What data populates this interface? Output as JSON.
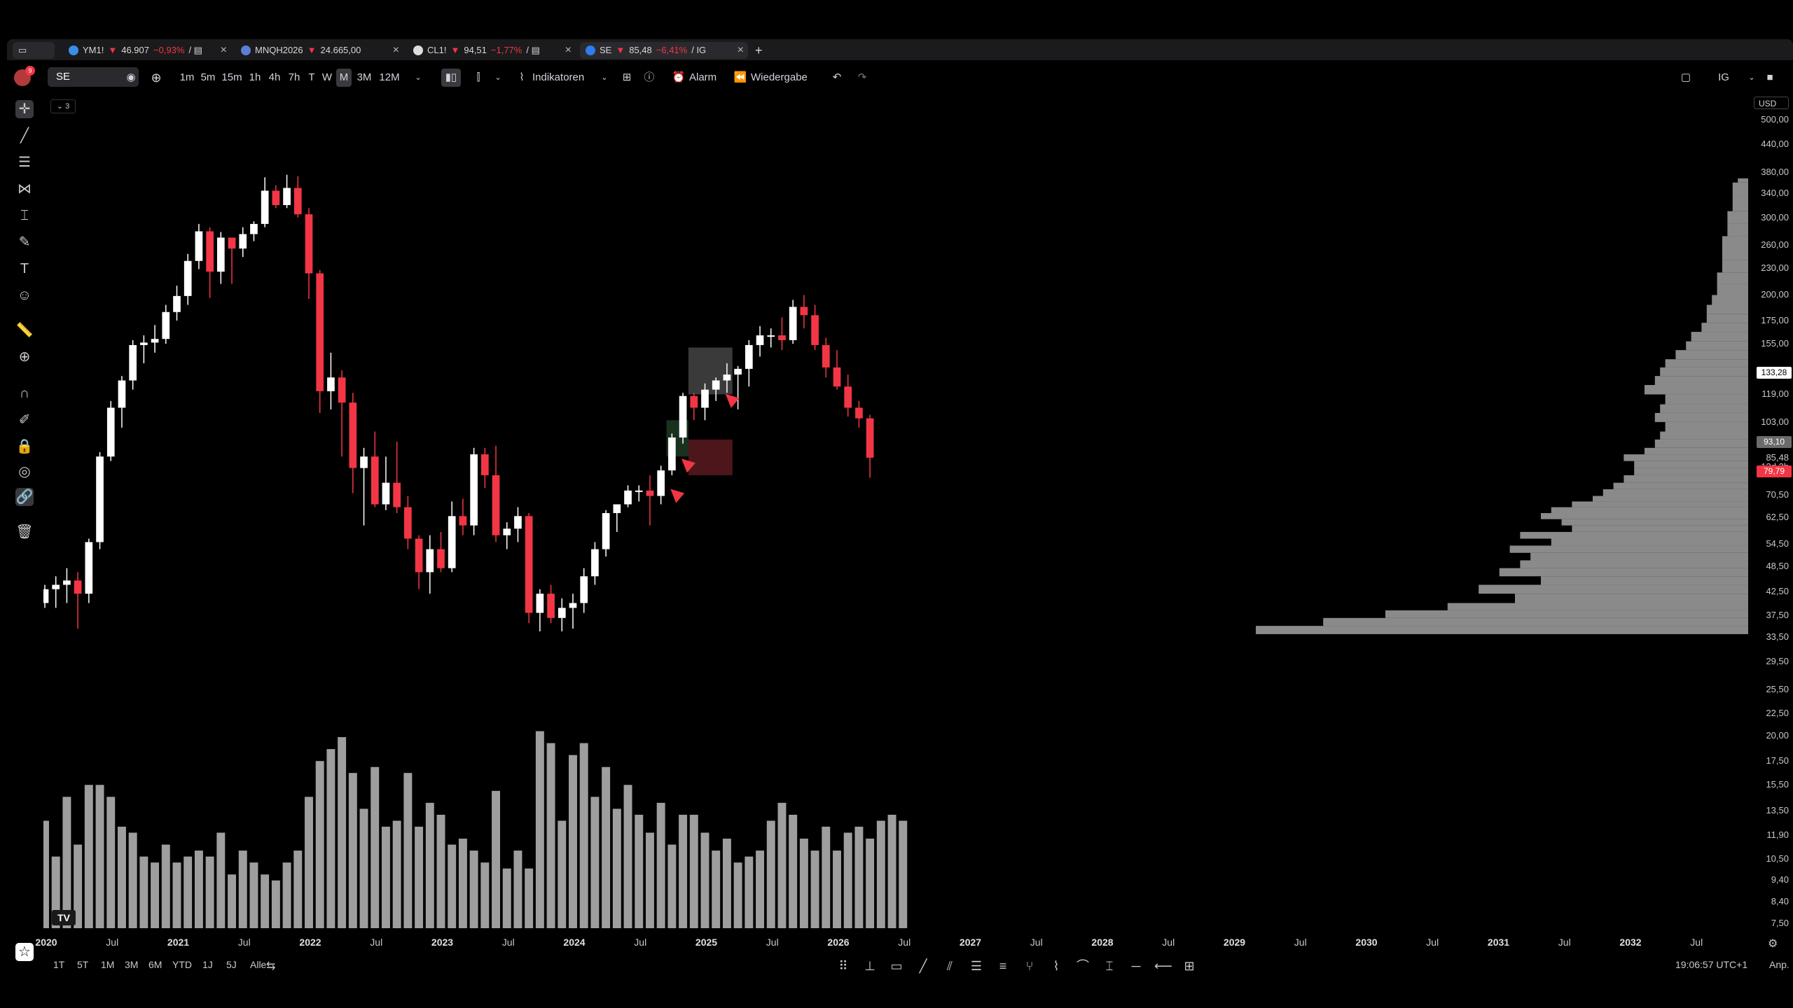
{
  "tabs": [
    {
      "symbol": "YM1!",
      "arrow": "▼",
      "price": "46.907",
      "change": "−0,93%",
      "suffix": "/ ▤",
      "dot": "#3b8ee8"
    },
    {
      "symbol": "MNQH2026",
      "arrow": "▼",
      "price": "24.665,00",
      "change": "",
      "suffix": "",
      "dot": "#5b7fd6"
    },
    {
      "symbol": "CL1!",
      "arrow": "▼",
      "price": "94,51",
      "change": "−1,77%",
      "suffix": "/ ▤",
      "dot": "#dddddd"
    },
    {
      "symbol": "SE",
      "arrow": "▼",
      "price": "85,48",
      "change": "−6,41%",
      "suffix": "/ IG",
      "dot": "#2f7bf0"
    }
  ],
  "new_tab_label": "+",
  "toolbar": {
    "symbol": "SE",
    "intervals": [
      "1m",
      "5m",
      "15m",
      "1h",
      "4h",
      "7h",
      "T",
      "W",
      "M",
      "3M",
      "12M"
    ],
    "selected_interval": "M",
    "indicators_label": "Indikatoren",
    "alert_label": "Alarm",
    "replay_label": "Wiedergabe",
    "right_label": "IG"
  },
  "notification_count": "9",
  "collapse_label": "3",
  "currency_label": "USD",
  "price_axis": [
    "500,00",
    "440,00",
    "380,00",
    "340,00",
    "300,00",
    "260,00",
    "230,00",
    "200,00",
    "175,00",
    "155,00",
    "133,28",
    "119,00",
    "103,00",
    "93,10",
    "85,48",
    "13d 2h",
    "79,79",
    "70,50",
    "62,50",
    "54,50",
    "48,50",
    "42,50",
    "37,50",
    "33,50",
    "29,50",
    "25,50",
    "22,50",
    "20,00",
    "17,50",
    "15,50",
    "13,50",
    "11,90",
    "10,50",
    "9,40",
    "8,40",
    "7,50"
  ],
  "price_tags": {
    "high_marker": "133,28",
    "last_label": "93,10",
    "current": "85,48",
    "countdown": "13d 2h",
    "low_marker": "79,79"
  },
  "colors": {
    "up": "#ffffff",
    "down": "#f23645",
    "volume": "#9e9e9e",
    "profile": "#8a8a8a",
    "tag_red": "#f23645",
    "tag_grey": "#6b6b6b",
    "zone_green": "#1e3a22",
    "zone_red": "#5a1a20",
    "zone_grey": "#444444"
  },
  "x_axis": [
    {
      "label": "2020",
      "year": true
    },
    {
      "label": "Jul",
      "year": false
    },
    {
      "label": "2021",
      "year": true
    },
    {
      "label": "Jul",
      "year": false
    },
    {
      "label": "2022",
      "year": true
    },
    {
      "label": "Jul",
      "year": false
    },
    {
      "label": "2023",
      "year": true
    },
    {
      "label": "Jul",
      "year": false
    },
    {
      "label": "2024",
      "year": true
    },
    {
      "label": "Jul",
      "year": false
    },
    {
      "label": "2025",
      "year": true
    },
    {
      "label": "Jul",
      "year": false
    },
    {
      "label": "2026",
      "year": true
    },
    {
      "label": "Jul",
      "year": false
    },
    {
      "label": "2027",
      "year": true
    },
    {
      "label": "Jul",
      "year": false
    },
    {
      "label": "2028",
      "year": true
    },
    {
      "label": "Jul",
      "year": false
    },
    {
      "label": "2029",
      "year": true
    },
    {
      "label": "Jul",
      "year": false
    },
    {
      "label": "2030",
      "year": true
    },
    {
      "label": "Jul",
      "year": false
    },
    {
      "label": "2031",
      "year": true
    },
    {
      "label": "Jul",
      "year": false
    },
    {
      "label": "2032",
      "year": true
    },
    {
      "label": "Jul",
      "year": false
    }
  ],
  "ranges": [
    "1T",
    "5T",
    "1M",
    "3M",
    "6M",
    "YTD",
    "1J",
    "5J",
    "Alle"
  ],
  "clock": "19:06:57 UTC+1",
  "adj_label": "Anp.",
  "logo_text": "TV",
  "chart_data": {
    "type": "candlestick",
    "symbol": "SE",
    "interval": "monthly",
    "y_scale": "log",
    "ylim": [
      7.0,
      560
    ],
    "candles": [
      {
        "d": "2019-12",
        "o": 40,
        "h": 44,
        "l": 39,
        "c": 43
      },
      {
        "d": "2020-01",
        "o": 43,
        "h": 46,
        "l": 39,
        "c": 44
      },
      {
        "d": "2020-02",
        "o": 44,
        "h": 48,
        "l": 40,
        "c": 45
      },
      {
        "d": "2020-03",
        "o": 45,
        "h": 47,
        "l": 35,
        "c": 42
      },
      {
        "d": "2020-04",
        "o": 42,
        "h": 56,
        "l": 40,
        "c": 55
      },
      {
        "d": "2020-05",
        "o": 55,
        "h": 88,
        "l": 53,
        "c": 86
      },
      {
        "d": "2020-06",
        "o": 86,
        "h": 115,
        "l": 84,
        "c": 111
      },
      {
        "d": "2020-07",
        "o": 111,
        "h": 131,
        "l": 100,
        "c": 128
      },
      {
        "d": "2020-08",
        "o": 128,
        "h": 158,
        "l": 122,
        "c": 154
      },
      {
        "d": "2020-09",
        "o": 154,
        "h": 162,
        "l": 140,
        "c": 156
      },
      {
        "d": "2020-10",
        "o": 156,
        "h": 171,
        "l": 148,
        "c": 159
      },
      {
        "d": "2020-11",
        "o": 159,
        "h": 190,
        "l": 155,
        "c": 183
      },
      {
        "d": "2020-12",
        "o": 183,
        "h": 210,
        "l": 175,
        "c": 199
      },
      {
        "d": "2021-01",
        "o": 199,
        "h": 248,
        "l": 190,
        "c": 239
      },
      {
        "d": "2021-02",
        "o": 239,
        "h": 290,
        "l": 229,
        "c": 279
      },
      {
        "d": "2021-03",
        "o": 279,
        "h": 285,
        "l": 197,
        "c": 226
      },
      {
        "d": "2021-04",
        "o": 226,
        "h": 278,
        "l": 212,
        "c": 270
      },
      {
        "d": "2021-05",
        "o": 270,
        "h": 270,
        "l": 212,
        "c": 255
      },
      {
        "d": "2021-06",
        "o": 255,
        "h": 285,
        "l": 244,
        "c": 275
      },
      {
        "d": "2021-07",
        "o": 275,
        "h": 294,
        "l": 265,
        "c": 290
      },
      {
        "d": "2021-08",
        "o": 290,
        "h": 370,
        "l": 285,
        "c": 345
      },
      {
        "d": "2021-09",
        "o": 345,
        "h": 355,
        "l": 315,
        "c": 320
      },
      {
        "d": "2021-10",
        "o": 320,
        "h": 375,
        "l": 315,
        "c": 350
      },
      {
        "d": "2021-11",
        "o": 350,
        "h": 372,
        "l": 300,
        "c": 305
      },
      {
        "d": "2021-12",
        "o": 305,
        "h": 315,
        "l": 196,
        "c": 224
      },
      {
        "d": "2022-01",
        "o": 224,
        "h": 228,
        "l": 108,
        "c": 121
      },
      {
        "d": "2022-02",
        "o": 121,
        "h": 148,
        "l": 110,
        "c": 130
      },
      {
        "d": "2022-03",
        "o": 130,
        "h": 135,
        "l": 86,
        "c": 114
      },
      {
        "d": "2022-04",
        "o": 114,
        "h": 120,
        "l": 71,
        "c": 81
      },
      {
        "d": "2022-05",
        "o": 81,
        "h": 90,
        "l": 60,
        "c": 86
      },
      {
        "d": "2022-06",
        "o": 86,
        "h": 98,
        "l": 66,
        "c": 67
      },
      {
        "d": "2022-07",
        "o": 67,
        "h": 86,
        "l": 65,
        "c": 75
      },
      {
        "d": "2022-08",
        "o": 75,
        "h": 93,
        "l": 64,
        "c": 66
      },
      {
        "d": "2022-09",
        "o": 66,
        "h": 70,
        "l": 53,
        "c": 56
      },
      {
        "d": "2022-10",
        "o": 56,
        "h": 57,
        "l": 43,
        "c": 47
      },
      {
        "d": "2022-11",
        "o": 47,
        "h": 57,
        "l": 42,
        "c": 53
      },
      {
        "d": "2022-12",
        "o": 53,
        "h": 58,
        "l": 47,
        "c": 48
      },
      {
        "d": "2023-01",
        "o": 48,
        "h": 68,
        "l": 47,
        "c": 63
      },
      {
        "d": "2023-02",
        "o": 63,
        "h": 69,
        "l": 57,
        "c": 60
      },
      {
        "d": "2023-03",
        "o": 60,
        "h": 90,
        "l": 57,
        "c": 87
      },
      {
        "d": "2023-04",
        "o": 87,
        "h": 90,
        "l": 73,
        "c": 78
      },
      {
        "d": "2023-05",
        "o": 78,
        "h": 91,
        "l": 55,
        "c": 57
      },
      {
        "d": "2023-06",
        "o": 57,
        "h": 61,
        "l": 53,
        "c": 59
      },
      {
        "d": "2023-07",
        "o": 59,
        "h": 66,
        "l": 55,
        "c": 63
      },
      {
        "d": "2023-08",
        "o": 63,
        "h": 64,
        "l": 36,
        "c": 38
      },
      {
        "d": "2023-09",
        "o": 38,
        "h": 43,
        "l": 34.5,
        "c": 42
      },
      {
        "d": "2023-10",
        "o": 42,
        "h": 44,
        "l": 36,
        "c": 37
      },
      {
        "d": "2023-11",
        "o": 37,
        "h": 41,
        "l": 34.5,
        "c": 39
      },
      {
        "d": "2023-12",
        "o": 39,
        "h": 42,
        "l": 35,
        "c": 40
      },
      {
        "d": "2024-01",
        "o": 40,
        "h": 48,
        "l": 38,
        "c": 46
      },
      {
        "d": "2024-02",
        "o": 46,
        "h": 55,
        "l": 44,
        "c": 53
      },
      {
        "d": "2024-03",
        "o": 53,
        "h": 65,
        "l": 51,
        "c": 64
      },
      {
        "d": "2024-04",
        "o": 64,
        "h": 67,
        "l": 58,
        "c": 67
      },
      {
        "d": "2024-05",
        "o": 67,
        "h": 74,
        "l": 66,
        "c": 72
      },
      {
        "d": "2024-06",
        "o": 72,
        "h": 74,
        "l": 68,
        "c": 72
      },
      {
        "d": "2024-07",
        "o": 72,
        "h": 78,
        "l": 60,
        "c": 70
      },
      {
        "d": "2024-08",
        "o": 70,
        "h": 82,
        "l": 67,
        "c": 80
      },
      {
        "d": "2024-09",
        "o": 80,
        "h": 97,
        "l": 78,
        "c": 95
      },
      {
        "d": "2024-10",
        "o": 95,
        "h": 120,
        "l": 92,
        "c": 118
      },
      {
        "d": "2024-11",
        "o": 118,
        "h": 120,
        "l": 104,
        "c": 111
      },
      {
        "d": "2024-12",
        "o": 111,
        "h": 126,
        "l": 104,
        "c": 122
      },
      {
        "d": "2025-01",
        "o": 122,
        "h": 130,
        "l": 115,
        "c": 128
      },
      {
        "d": "2025-02",
        "o": 128,
        "h": 140,
        "l": 120,
        "c": 132
      },
      {
        "d": "2025-03",
        "o": 132,
        "h": 138,
        "l": 110,
        "c": 136
      },
      {
        "d": "2025-04",
        "o": 136,
        "h": 158,
        "l": 124,
        "c": 154
      },
      {
        "d": "2025-05",
        "o": 154,
        "h": 170,
        "l": 145,
        "c": 162
      },
      {
        "d": "2025-06",
        "o": 162,
        "h": 168,
        "l": 152,
        "c": 162
      },
      {
        "d": "2025-07",
        "o": 162,
        "h": 178,
        "l": 150,
        "c": 158
      },
      {
        "d": "2025-08",
        "o": 158,
        "h": 195,
        "l": 155,
        "c": 188
      },
      {
        "d": "2025-09",
        "o": 188,
        "h": 200,
        "l": 168,
        "c": 180
      },
      {
        "d": "2025-10",
        "o": 180,
        "h": 190,
        "l": 150,
        "c": 154
      },
      {
        "d": "2025-11",
        "o": 154,
        "h": 160,
        "l": 130,
        "c": 137
      },
      {
        "d": "2025-12",
        "o": 137,
        "h": 150,
        "l": 122,
        "c": 124
      },
      {
        "d": "2026-01",
        "o": 124,
        "h": 132,
        "l": 106,
        "c": 111
      },
      {
        "d": "2026-02",
        "o": 111,
        "h": 115,
        "l": 100,
        "c": 105
      },
      {
        "d": "2026-03",
        "o": 105,
        "h": 107,
        "l": 77,
        "c": 85.48
      }
    ],
    "volume": [
      18,
      12,
      22,
      14,
      24,
      24,
      22,
      17,
      16,
      12,
      11,
      14,
      11,
      12,
      13,
      12,
      16,
      9,
      13,
      11,
      9,
      8,
      11,
      13,
      22,
      28,
      30,
      32,
      26,
      20,
      27,
      17,
      18,
      26,
      17,
      21,
      19,
      14,
      15,
      13,
      11,
      23,
      10,
      13,
      10,
      33,
      31,
      18,
      29,
      31,
      22,
      27,
      20,
      24,
      19,
      16,
      21,
      14,
      19,
      19,
      16,
      13,
      15,
      11,
      12,
      13,
      18,
      21,
      19,
      15,
      13,
      17,
      13,
      16,
      17,
      15,
      18,
      19,
      18
    ],
    "volume_profile": [
      {
        "price": 34.0,
        "w": 0.95
      },
      {
        "price": 35.5,
        "w": 0.82
      },
      {
        "price": 37.0,
        "w": 0.7
      },
      {
        "price": 38.5,
        "w": 0.58
      },
      {
        "price": 40.0,
        "w": 0.45
      },
      {
        "price": 42.0,
        "w": 0.52
      },
      {
        "price": 44.0,
        "w": 0.4
      },
      {
        "price": 46.0,
        "w": 0.48
      },
      {
        "price": 48.0,
        "w": 0.44
      },
      {
        "price": 50.0,
        "w": 0.42
      },
      {
        "price": 52.0,
        "w": 0.46
      },
      {
        "price": 54.0,
        "w": 0.38
      },
      {
        "price": 56.0,
        "w": 0.44
      },
      {
        "price": 58.0,
        "w": 0.34
      },
      {
        "price": 60.0,
        "w": 0.36
      },
      {
        "price": 62.0,
        "w": 0.4
      },
      {
        "price": 64.0,
        "w": 0.38
      },
      {
        "price": 66.0,
        "w": 0.34
      },
      {
        "price": 68.0,
        "w": 0.3
      },
      {
        "price": 70.0,
        "w": 0.28
      },
      {
        "price": 72.5,
        "w": 0.26
      },
      {
        "price": 75.0,
        "w": 0.24
      },
      {
        "price": 78.0,
        "w": 0.22
      },
      {
        "price": 81.0,
        "w": 0.22
      },
      {
        "price": 84.0,
        "w": 0.24
      },
      {
        "price": 87.0,
        "w": 0.2
      },
      {
        "price": 90.0,
        "w": 0.18
      },
      {
        "price": 94.0,
        "w": 0.17
      },
      {
        "price": 98.0,
        "w": 0.16
      },
      {
        "price": 103.0,
        "w": 0.18
      },
      {
        "price": 108.0,
        "w": 0.17
      },
      {
        "price": 113.0,
        "w": 0.16
      },
      {
        "price": 119.0,
        "w": 0.2
      },
      {
        "price": 125.0,
        "w": 0.18
      },
      {
        "price": 131.0,
        "w": 0.17
      },
      {
        "price": 137.0,
        "w": 0.16
      },
      {
        "price": 143.0,
        "w": 0.14
      },
      {
        "price": 150.0,
        "w": 0.12
      },
      {
        "price": 157.0,
        "w": 0.11
      },
      {
        "price": 165.0,
        "w": 0.09
      },
      {
        "price": 173.0,
        "w": 0.08
      },
      {
        "price": 181.0,
        "w": 0.08
      },
      {
        "price": 190.0,
        "w": 0.07
      },
      {
        "price": 200.0,
        "w": 0.06
      },
      {
        "price": 212.0,
        "w": 0.06
      },
      {
        "price": 225.0,
        "w": 0.05
      },
      {
        "price": 240.0,
        "w": 0.05
      },
      {
        "price": 256.0,
        "w": 0.05
      },
      {
        "price": 272.0,
        "w": 0.04
      },
      {
        "price": 290.0,
        "w": 0.04
      },
      {
        "price": 310.0,
        "w": 0.03
      },
      {
        "price": 335.0,
        "w": 0.03
      },
      {
        "price": 360.0,
        "w": 0.02
      }
    ],
    "zones": [
      {
        "from": "2024-11",
        "to": "2025-02",
        "low": 119,
        "high": 152,
        "color": "grey"
      },
      {
        "from": "2024-09",
        "to": "2024-10",
        "low": 86,
        "high": 104,
        "color": "green"
      },
      {
        "from": "2024-11",
        "to": "2025-02",
        "low": 78,
        "high": 94,
        "color": "red"
      }
    ],
    "markers": [
      {
        "d": "2024-09",
        "price": 70,
        "color": "red"
      },
      {
        "d": "2024-10",
        "price": 82,
        "color": "red"
      },
      {
        "d": "2025-02",
        "price": 115,
        "color": "red"
      }
    ]
  }
}
